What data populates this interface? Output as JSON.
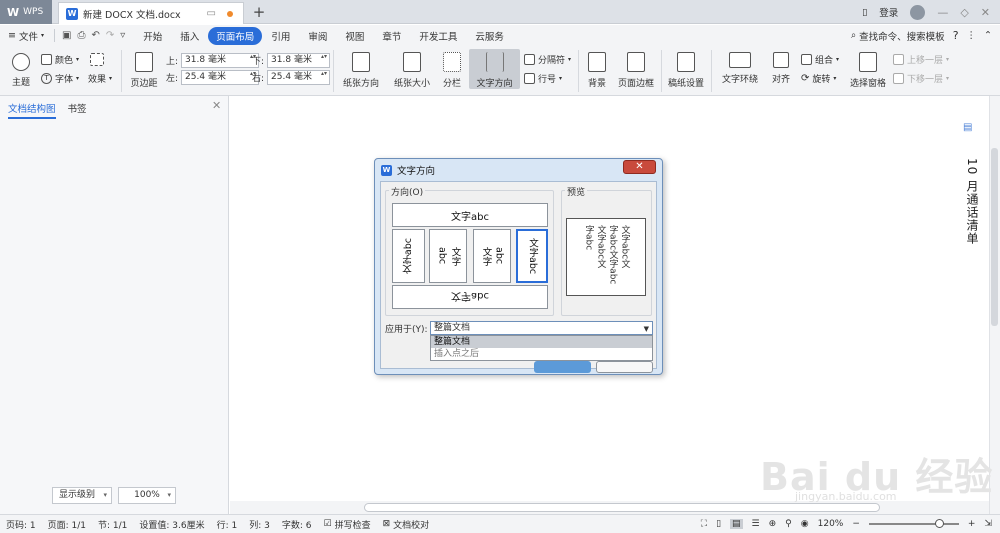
{
  "tabbar": {
    "app_label": "WPS",
    "doc_tab_title": "新建 DOCX 文档.docx",
    "new_tab": "+",
    "login": "登录"
  },
  "menu": {
    "file": "文件",
    "items": [
      "开始",
      "插入",
      "页面布局",
      "引用",
      "审阅",
      "视图",
      "章节",
      "开发工具",
      "云服务"
    ],
    "active_index": 2,
    "search": "查找命令、搜索模板",
    "help": "?"
  },
  "ribbon": {
    "theme": "主题",
    "color": "颜色",
    "font": "字体",
    "effect": "效果",
    "margins": "页边距",
    "top_label": "上:",
    "top_value": "31.8 毫米",
    "bottom_label": "下:",
    "bottom_value": "31.8 毫米",
    "left_label": "左:",
    "left_value": "25.4 毫米",
    "right_label": "右:",
    "right_value": "25.4 毫米",
    "orientation": "纸张方向",
    "size": "纸张大小",
    "columns": "分栏",
    "text_direction": "文字方向",
    "breaks": "分隔符",
    "line_numbers": "行号",
    "background": "背景",
    "page_border": "页面边框",
    "draft_paper": "稿纸设置",
    "wrap_text": "文字环绕",
    "align": "对齐",
    "group": "组合",
    "rotate": "旋转",
    "selection_pane": "选择窗格",
    "bring_forward": "上移一层",
    "send_backward": "下移一层"
  },
  "leftpanel": {
    "tab_outline": "文档结构图",
    "tab_bookmarks": "书签",
    "level_select": "显示级别",
    "zoom_select": "100%"
  },
  "document": {
    "vertical_title": "10 月通话清单"
  },
  "dialog": {
    "title": "文字方向",
    "direction_label": "方向(O)",
    "preview_label": "预览",
    "opt_horizontal": "文字abc",
    "opt_v1": "文字abc",
    "opt_v2_col1": "文字",
    "opt_v2_col2": "abc",
    "opt_v3_col1": "文字",
    "opt_v3_col2": "abc",
    "opt_v4": "文字abc",
    "opt_bottom": "文字abc",
    "preview_lines": [
      "文字abc文",
      "字abc文字abc",
      "文字abc文",
      "字abc"
    ],
    "apply_label": "应用于(Y):",
    "apply_value": "整篇文档",
    "apply_options": [
      "整篇文档",
      "插入点之后"
    ]
  },
  "status": {
    "page_num": "页码: 1",
    "pages": "页面: 1/1",
    "section": "节: 1/1",
    "setting": "设置值: 3.6厘米",
    "row": "行: 1",
    "col": "列: 3",
    "words": "字数: 6",
    "spell": "拼写检查",
    "proof": "文档校对",
    "zoom": "120%"
  },
  "watermark": {
    "main": "Bai du 经验",
    "sub": "jingyan.baidu.com"
  }
}
